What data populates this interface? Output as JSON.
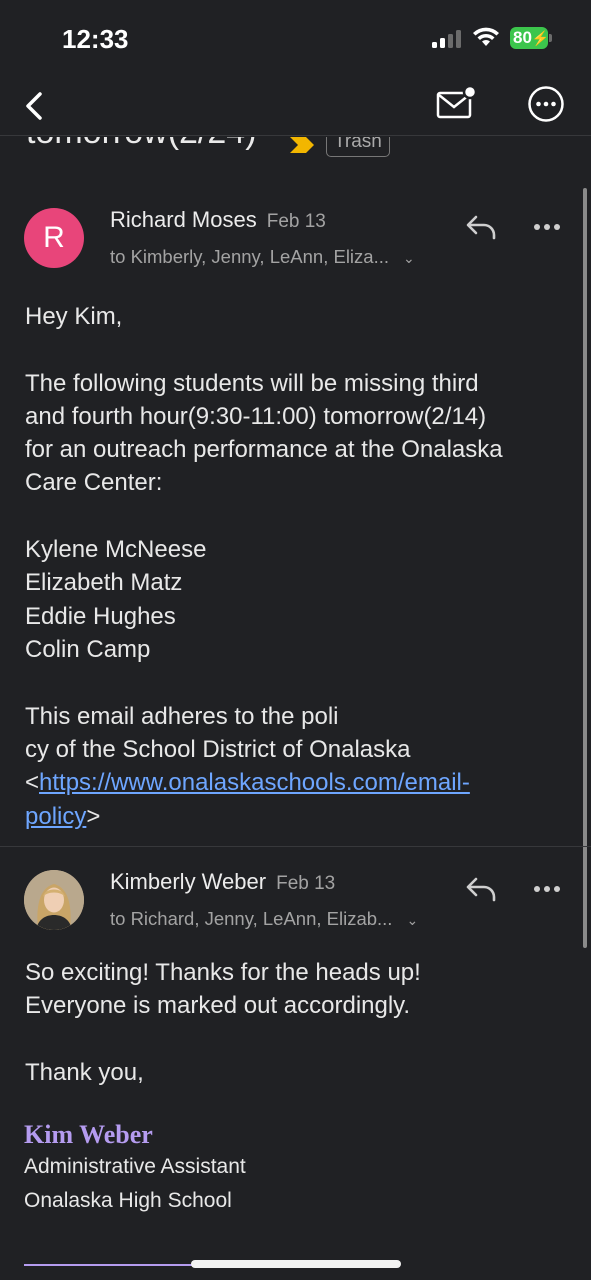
{
  "status": {
    "time": "12:33",
    "battery": "80"
  },
  "subject": {
    "text": "tomorrow(2/24)",
    "label": "Trash"
  },
  "messages": [
    {
      "avatar_letter": "R",
      "sender": "Richard Moses",
      "date": "Feb 13",
      "recipients": "to Kimberly, Jenny, LeAnn, Eliza...",
      "body": "Hey Kim,\n\nThe following students will be missing third\nand fourth hour(9:30-11:00) tomorrow(2/14)\nfor an outreach performance at the Onalaska\nCare Center:\n\nKylene McNeese\nElizabeth Matz\nEddie Hughes\nColin Camp\n\nThis email adheres to the poli\ncy of the School District of Onalaska",
      "policy_link_part1": "https://www.onalaskaschools.com/email-",
      "policy_link_part2": "policy",
      "lt": "<",
      "gt": ">"
    },
    {
      "sender": "Kimberly Weber",
      "date": "Feb 13",
      "recipients": "to Richard, Jenny, LeAnn, Elizab...",
      "body": "So exciting! Thanks for the heads up!\nEveryone is marked out accordingly.\n\nThank you,",
      "signature": {
        "name": "Kim Weber",
        "title": "Administrative Assistant",
        "school": "Onalaska High School"
      }
    }
  ],
  "icons": {
    "back": "chevron-left-icon",
    "unread": "mail-unread-icon",
    "more": "more-circle-icon",
    "reply": "reply-icon",
    "overflow": "more-horizontal-icon",
    "label": "important-label-icon"
  },
  "colors": {
    "background": "#202124",
    "avatar_r": "#e8457a",
    "link": "#6ea6ff",
    "signature": "#b59cf0",
    "label_arrow": "#f2b600",
    "battery": "#3cc54c"
  }
}
